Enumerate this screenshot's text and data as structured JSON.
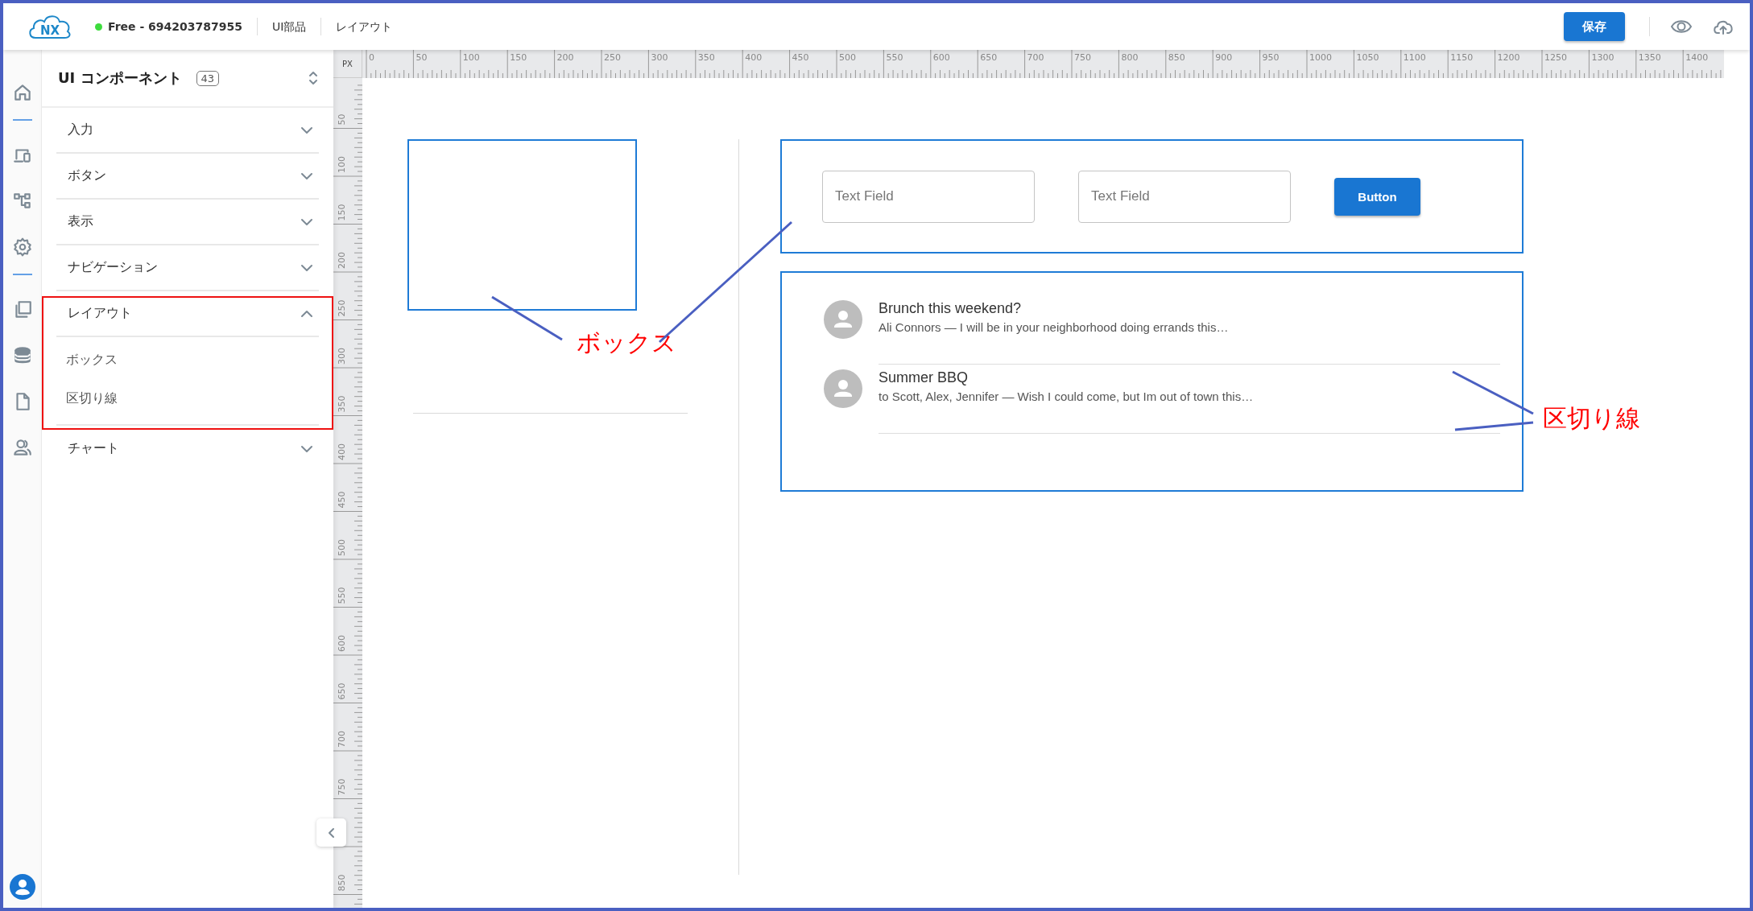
{
  "top_bar": {
    "logo": "NX",
    "plan_status": "Free - 694203787955",
    "breadcrumbs": [
      "UI部品",
      "レイアウト"
    ],
    "save_button": "保存"
  },
  "sidebar": {
    "title": "UI コンポーネント",
    "count": "43",
    "categories": [
      {
        "label": "入力",
        "expanded": false
      },
      {
        "label": "ボタン",
        "expanded": false
      },
      {
        "label": "表示",
        "expanded": false
      },
      {
        "label": "ナビゲーション",
        "expanded": false
      },
      {
        "label": "レイアウト",
        "expanded": true,
        "children": [
          {
            "label": "ボックス"
          },
          {
            "label": "区切り線"
          }
        ]
      },
      {
        "label": "チャート",
        "expanded": false
      }
    ]
  },
  "ruler": {
    "unit": "PX",
    "x_labels": [
      "0",
      "50",
      "100",
      "150",
      "200",
      "250",
      "300",
      "350",
      "400",
      "450",
      "500",
      "550",
      "600",
      "650",
      "700",
      "750",
      "800",
      "850",
      "900",
      "950",
      "1000",
      "1050",
      "1100",
      "1150",
      "1200",
      "1250",
      "1300",
      "1350",
      "1400"
    ],
    "y_labels": [
      "50",
      "100",
      "150",
      "200",
      "250",
      "300",
      "350",
      "400",
      "450",
      "500",
      "550",
      "600",
      "650",
      "700",
      "750",
      "850"
    ]
  },
  "canvas": {
    "text_fields": [
      {
        "placeholder": "Text Field"
      },
      {
        "placeholder": "Text Field"
      }
    ],
    "button": "Button",
    "list_items": [
      {
        "title": "Brunch this weekend?",
        "text": "Ali Connors — I will be in your neighborhood doing errands this…"
      },
      {
        "title": "Summer BBQ",
        "text": "to Scott, Alex, Jennifer — Wish I could come, but Im out of town this…"
      }
    ]
  },
  "annotations": [
    {
      "label": "ボックス"
    },
    {
      "label": "区切り線"
    }
  ]
}
